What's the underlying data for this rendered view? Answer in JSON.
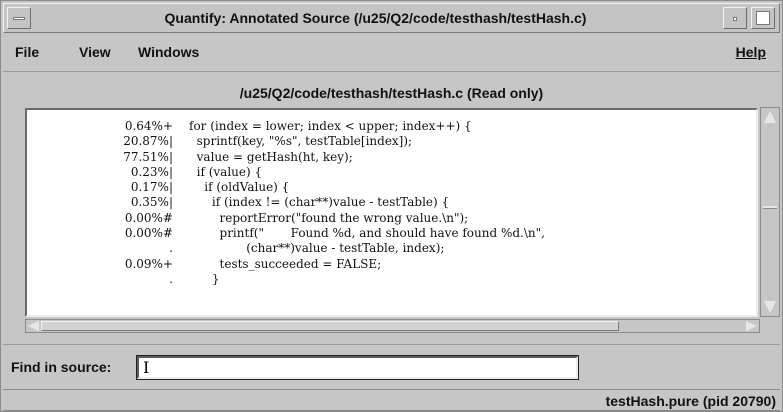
{
  "window": {
    "title": "Quantify: Annotated Source (/u25/Q2/code/testhash/testHash.c)"
  },
  "menu": {
    "file": "File",
    "view": "View",
    "windows": "Windows",
    "help": "Help"
  },
  "source": {
    "heading": "/u25/Q2/code/testhash/testHash.c (Read only)",
    "lines": [
      {
        "pct": "0.64%+",
        "code": "for (index = lower; index < upper; index++) {"
      },
      {
        "pct": "20.87%|",
        "code": "  sprintf(key, \"%s\", testTable[index]);"
      },
      {
        "pct": "77.51%|",
        "code": "  value = getHash(ht, key);"
      },
      {
        "pct": "0.23%|",
        "code": "  if (value) {"
      },
      {
        "pct": "0.17%|",
        "code": "    if (oldValue) {"
      },
      {
        "pct": "0.35%|",
        "code": "      if (index != (char**)value - testTable) {"
      },
      {
        "pct": "0.00%#",
        "code": "        reportError(\"found the wrong value.\\n\");"
      },
      {
        "pct": "0.00%#",
        "code": "        printf(\"       Found %d, and should have found %d.\\n\","
      },
      {
        "pct": ".",
        "code": "               (char**)value - testTable, index);"
      },
      {
        "pct": "0.09%+",
        "code": "        tests_succeeded = FALSE;"
      },
      {
        "pct": ".",
        "code": "      }"
      }
    ]
  },
  "find": {
    "label": "Find in source:",
    "value": ""
  },
  "status": {
    "text": "testHash.pure (pid 20790)"
  }
}
